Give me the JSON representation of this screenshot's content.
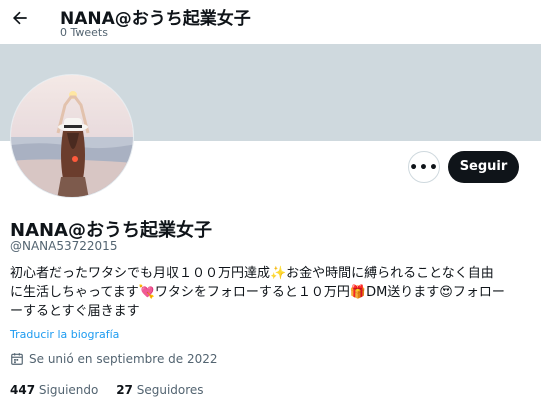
{
  "header": {
    "name": "NANA@おうち起業女子",
    "tweet_count": "0 Tweets"
  },
  "profile": {
    "name": "NANA@おうち起業女子",
    "handle": "@NANA53722015",
    "bio": "初心者だったワタシでも月収１００万円達成✨お金や時間に縛られることなく自由\nに生活しちゃってます💘ワタシをフォローすると１０万円🎁DM送ります😍フォロー\nーするとすぐ届きます",
    "translate_label": "Traducir la biografía",
    "joined": "Se unió en septiembre de 2022",
    "following_count": "447",
    "following_label": "Siguiendo",
    "followers_count": "27",
    "followers_label": "Seguidores"
  },
  "actions": {
    "more_label": "•••",
    "follow_label": "Seguir"
  },
  "colors": {
    "banner": "#cfd9de",
    "accent": "#1d9bf0",
    "button": "#0f1419"
  },
  "icons": [
    "back-arrow-icon",
    "more-icon",
    "calendar-icon"
  ]
}
